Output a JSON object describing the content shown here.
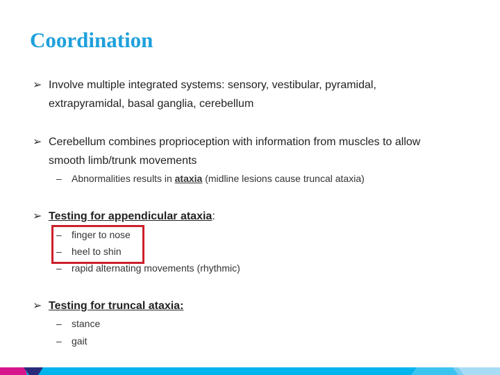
{
  "slide": {
    "title": "Coordination",
    "accent_color": "#1ea0db",
    "highlight_color": "#cc1f2a",
    "bullet_glyph": "➢",
    "dash_glyph": "–",
    "items": [
      {
        "bullet_icon": "arrow-bullet-icon",
        "line1": "Involve multiple integrated systems: sensory, vestibular, pyramidal,",
        "line2": "extrapyramidal, basal ganglia, cerebellum"
      },
      {
        "bullet_icon": "arrow-bullet-icon",
        "line1": "Cerebellum combines proprioception with information from muscles to allow",
        "line2": "smooth limb/trunk movements",
        "sub": [
          {
            "prefix": "Abnormalities results in ",
            "emphasis": "ataxia",
            "suffix": " (midline lesions cause truncal ataxia)"
          }
        ]
      },
      {
        "bullet_icon": "arrow-bullet-icon",
        "heading": "Testing for appendicular ataxia",
        "heading_suffix": ":",
        "sub": [
          {
            "text": "finger to nose"
          },
          {
            "text": "heel to shin"
          },
          {
            "text": "rapid alternating movements (rhythmic)"
          }
        ]
      },
      {
        "bullet_icon": "arrow-bullet-icon",
        "heading": "Testing for truncal ataxia:",
        "sub": [
          {
            "text": "stance"
          },
          {
            "text": "gait"
          }
        ]
      }
    ]
  },
  "footer": {
    "colors": {
      "magenta": "#d6168c",
      "navy": "#2b2a7a",
      "cyan": "#00b4ed",
      "light_blue_1": "#3cc4f0",
      "light_blue_2": "#7dd0f2",
      "light_blue_3": "#a8dcf5"
    }
  }
}
